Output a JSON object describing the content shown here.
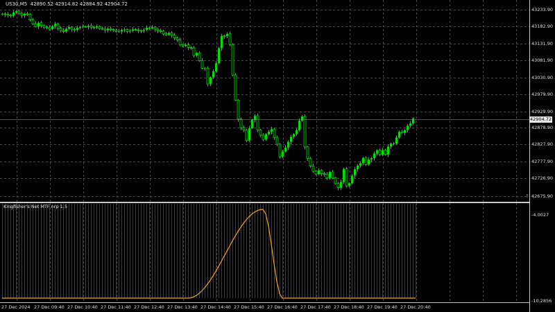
{
  "header": {
    "symbol": "US30,M5",
    "ohlc": "42890.52 42914.82 42884.92 42904.72"
  },
  "indicator": {
    "label": "Kingfisher's Net MTF nrp 1.5",
    "axis_max": "-4.0027",
    "axis_min": "-10.2856"
  },
  "price_axis": {
    "ticks": [
      "43233.90",
      "43182.90",
      "43131.90",
      "43081.90",
      "43030.90",
      "42979.90",
      "42929.90",
      "42878.90",
      "42827.90",
      "42777.90",
      "42726.90",
      "42675.90"
    ],
    "current_price": "42904.72"
  },
  "time_axis": {
    "labels": [
      "27 Dec 2024",
      "27 Dec 09:40",
      "27 Dec 10:40",
      "27 Dec 11:40",
      "27 Dec 12:40",
      "27 Dec 13:40",
      "27 Dec 14:40",
      "27 Dec 15:40",
      "27 Dec 16:40",
      "27 Dec 17:40",
      "27 Dec 18:40",
      "27 Dec 19:40",
      "27 Dec 20:40"
    ]
  },
  "colors": {
    "background": "#000000",
    "grid": "#4a4a4a",
    "candle": "#00e000",
    "histogram": "#8b1a1a",
    "indicator_line": "#ffa500",
    "text": "#e6e6e6"
  },
  "chart_data": {
    "type": "candlestick",
    "timeframe": "M5",
    "x_start": "27 Dec 2024 08:00",
    "price_range": [
      42660,
      43255
    ],
    "close": [
      43218,
      43216,
      43214,
      43212,
      43222,
      43226,
      43218,
      43213,
      43218,
      43217,
      43200,
      43188,
      43180,
      43191,
      43183,
      43178,
      43176,
      43172,
      43181,
      43188,
      43175,
      43168,
      43165,
      43173,
      43178,
      43172,
      43170,
      43176,
      43178,
      43180,
      43179,
      43182,
      43178,
      43177,
      43180,
      43174,
      43172,
      43169,
      43174,
      43171,
      43168,
      43165,
      43165,
      43170,
      43171,
      43165,
      43167,
      43171,
      43170,
      43168,
      43167,
      43170,
      43176,
      43174,
      43178,
      43172,
      43167,
      43166,
      43158,
      43155,
      43161,
      43154,
      43146,
      43140,
      43126,
      43122,
      43125,
      43117,
      43116,
      43093,
      43101,
      43078,
      43055,
      43055,
      43008,
      43028,
      43046,
      43070,
      43115,
      43152,
      43151,
      43158,
      43126,
      43035,
      42960,
      42903,
      42877,
      42870,
      42839,
      42876,
      42901,
      42913,
      42870,
      42855,
      42842,
      42858,
      42865,
      42873,
      42848,
      42828,
      42790,
      42806,
      42818,
      42835,
      42850,
      42858,
      42870,
      42898,
      42911,
      42820,
      42785,
      42763,
      42747,
      42739,
      42750,
      42740,
      42738,
      42727,
      42745,
      42727,
      42710,
      42698,
      42715,
      42754,
      42703,
      42711,
      42734,
      42753,
      42764,
      42771,
      42787,
      42767,
      42782,
      42786,
      42800,
      42810,
      42797,
      42810,
      42797,
      42821,
      42830,
      42830,
      42848,
      42865,
      42862,
      42870,
      42883,
      42890,
      42905
    ],
    "histogram_length": 150,
    "line_curve": {
      "baseline": -10.2856,
      "peak": -4.0027,
      "rise_start": 67,
      "peak_index": 94,
      "fall_end": 101
    }
  }
}
